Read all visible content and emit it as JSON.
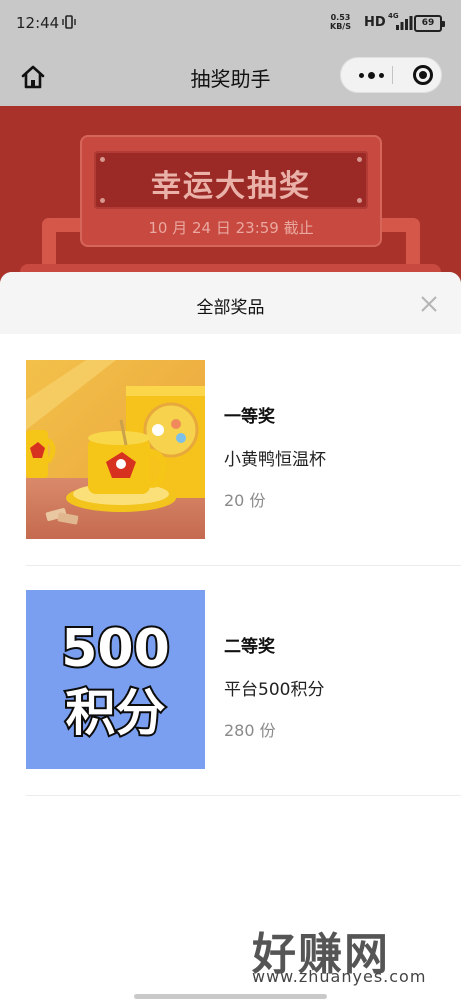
{
  "status_bar": {
    "time": "12:44",
    "net_speed_value": "0.53",
    "net_speed_unit": "KB/S",
    "hd_label": "HD",
    "network_label": "4G",
    "battery": "69"
  },
  "nav": {
    "title": "抽奖助手"
  },
  "banner": {
    "title": "幸运大抽奖",
    "deadline": "10 月 24 日 23:59 截止"
  },
  "sheet": {
    "title": "全部奖品",
    "prizes": [
      {
        "rank": "一等奖",
        "name": "小黄鸭恒温杯",
        "count": "20 份",
        "image": "duck-mug-photo"
      },
      {
        "rank": "二等奖",
        "name": "平台500积分",
        "count": "280 份",
        "image_text": [
          "500",
          "积分"
        ]
      }
    ]
  },
  "watermark": {
    "title": "好赚网",
    "url": "www.zhuanyes.com"
  },
  "colors": {
    "banner_red": "#a9322b",
    "points_blue": "#7b9ff0",
    "duck_yellow": "#f5c518"
  }
}
